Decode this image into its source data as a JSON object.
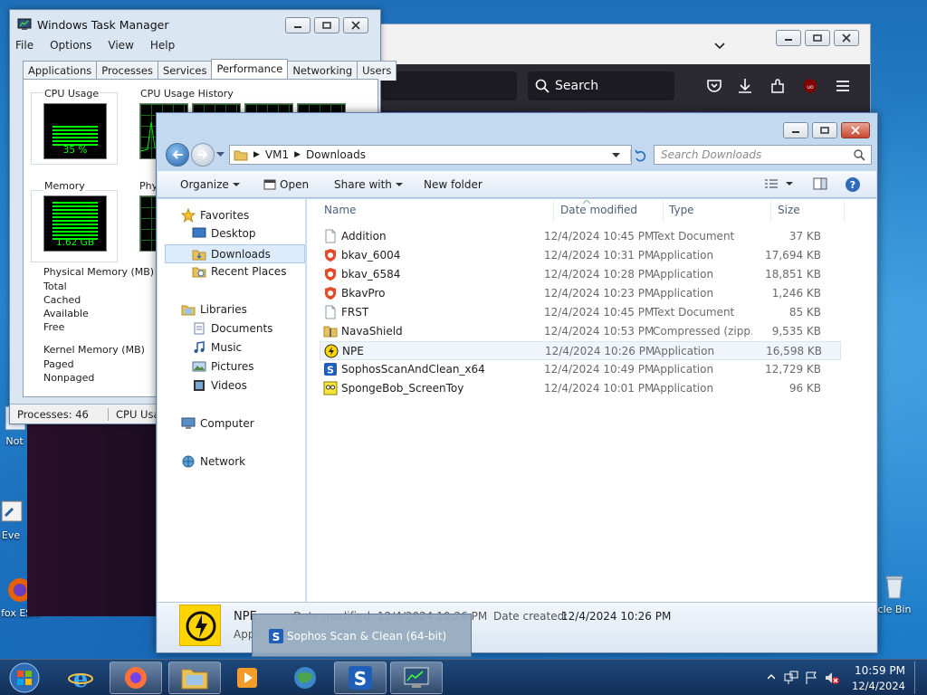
{
  "desktop": {
    "icons": [
      {
        "label": "Not"
      },
      {
        "label": "Eve"
      },
      {
        "label": "fox ESR"
      },
      {
        "label": "cle Bin"
      }
    ]
  },
  "firefox": {
    "search_placeholder": "Search"
  },
  "taskmanager": {
    "title": "Windows Task Manager",
    "menu": [
      "File",
      "Options",
      "View",
      "Help"
    ],
    "tabs": [
      "Applications",
      "Processes",
      "Services",
      "Performance",
      "Networking",
      "Users"
    ],
    "active_tab": "Performance",
    "cpu_usage_label": "CPU Usage",
    "cpu_usage_value": "35 %",
    "cpu_history_label": "CPU Usage History",
    "memory_label": "Memory",
    "memory_value": "1.62 GB",
    "phys_history_label_partial": "Phys",
    "physical_memory_label": "Physical Memory (MB)",
    "physical_rows": [
      "Total",
      "Cached",
      "Available",
      "Free"
    ],
    "kernel_memory_label": "Kernel Memory (MB)",
    "kernel_rows": [
      "Paged",
      "Nonpaged"
    ],
    "status_processes": "Processes: 46",
    "status_cpu": "CPU Usa"
  },
  "explorer": {
    "breadcrumb": [
      "VM1",
      "Downloads"
    ],
    "search_placeholder": "Search Downloads",
    "commands": {
      "organize": "Organize",
      "open": "Open",
      "share": "Share with",
      "new_folder": "New folder"
    },
    "nav": {
      "favorites": "Favorites",
      "desktop": "Desktop",
      "downloads": "Downloads",
      "recent": "Recent Places",
      "libraries": "Libraries",
      "documents": "Documents",
      "music": "Music",
      "pictures": "Pictures",
      "videos": "Videos",
      "computer": "Computer",
      "network": "Network"
    },
    "columns": {
      "name": "Name",
      "date": "Date modified",
      "type": "Type",
      "size": "Size"
    },
    "files": [
      {
        "name": "Addition",
        "date": "12/4/2024 10:45 PM",
        "type": "Text Document",
        "size": "37 KB"
      },
      {
        "name": "bkav_6004",
        "date": "12/4/2024 10:31 PM",
        "type": "Application",
        "size": "17,694 KB"
      },
      {
        "name": "bkav_6584",
        "date": "12/4/2024 10:28 PM",
        "type": "Application",
        "size": "18,851 KB"
      },
      {
        "name": "BkavPro",
        "date": "12/4/2024 10:23 PM",
        "type": "Application",
        "size": "1,246 KB"
      },
      {
        "name": "FRST",
        "date": "12/4/2024 10:45 PM",
        "type": "Text Document",
        "size": "85 KB"
      },
      {
        "name": "NavaShield",
        "date": "12/4/2024 10:53 PM",
        "type": "Compressed (zipp...",
        "size": "9,535 KB"
      },
      {
        "name": "NPE",
        "date": "12/4/2024 10:26 PM",
        "type": "Application",
        "size": "16,598 KB"
      },
      {
        "name": "SophosScanAndClean_x64",
        "date": "12/4/2024 10:49 PM",
        "type": "Application",
        "size": "12,729 KB"
      },
      {
        "name": "SpongeBob_ScreenToy",
        "date": "12/4/2024 10:01 PM",
        "type": "Application",
        "size": "96 KB"
      }
    ],
    "details": {
      "name": "NPE",
      "type": "App",
      "date_modified_partial": "Date modified: 12/4/2024 10:26 PM",
      "date_created_label": "Date created:",
      "date_created_value": "12/4/2024 10:26 PM"
    }
  },
  "tooltip": {
    "text": "Sophos Scan & Clean (64-bit)"
  },
  "taskbar": {
    "time": "10:59 PM",
    "date": "12/4/2024"
  }
}
